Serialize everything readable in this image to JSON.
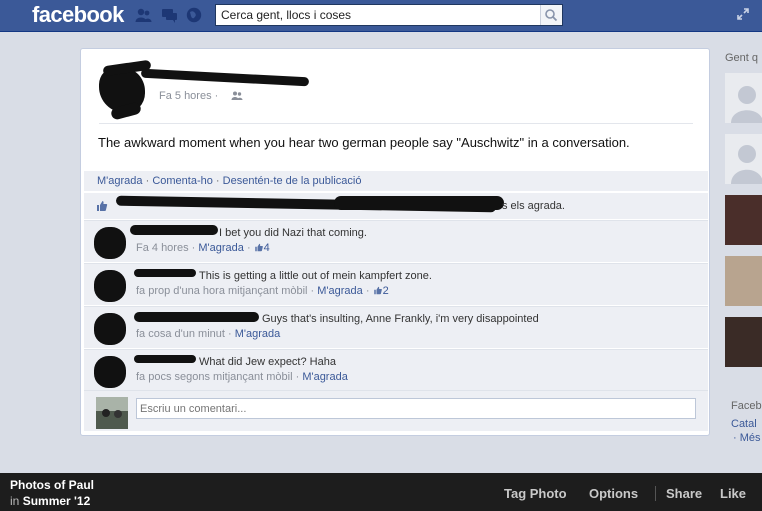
{
  "header": {
    "logo": "facebook",
    "search_placeholder": "Cerca gent, llocs i coses"
  },
  "post": {
    "time": "Fa 5 hores",
    "message": "The awkward moment when you hear two german people say \"Auschwitz\" in a conversation.",
    "actions": {
      "like": "M'agrada",
      "comment": "Comenta-ho",
      "unfollow": "Desentén-te de la publicació"
    },
    "likes_suffix": "s els agrada."
  },
  "comments": [
    {
      "text": "I bet you did Nazi that coming.",
      "time": "Fa 4 hores",
      "like": "M'agrada",
      "like_count": "4"
    },
    {
      "text": "This is getting a little out of mein kampfert zone.",
      "time": "fa prop d'una hora mitjançant mòbil",
      "like": "M'agrada",
      "like_count": "2"
    },
    {
      "text": "Guys that's insulting, Anne Frankly, i'm very disappointed",
      "time": "fa cosa d'un minut",
      "like": "M'agrada"
    },
    {
      "text": "What did Jew expect? Haha",
      "time": "fa pocs segons mitjançant mòbil",
      "like": "M'agrada"
    }
  ],
  "write_comment_placeholder": "Escriu un comentari...",
  "sidebar": {
    "title": "Gent q",
    "footer_title": "Faceb",
    "footer_lang": "Catal",
    "footer_more": "· Més"
  },
  "photo_bar": {
    "title": "Photos of Paul",
    "in_prefix": "in",
    "album": "Summer '12",
    "actions": {
      "tag": "Tag Photo",
      "options": "Options",
      "share": "Share",
      "like": "Like"
    }
  },
  "colors": {
    "brand": "#3b5998",
    "link": "#3b5998",
    "comment_bg": "#edeff4",
    "photo_bar": "#1d1d1d"
  }
}
